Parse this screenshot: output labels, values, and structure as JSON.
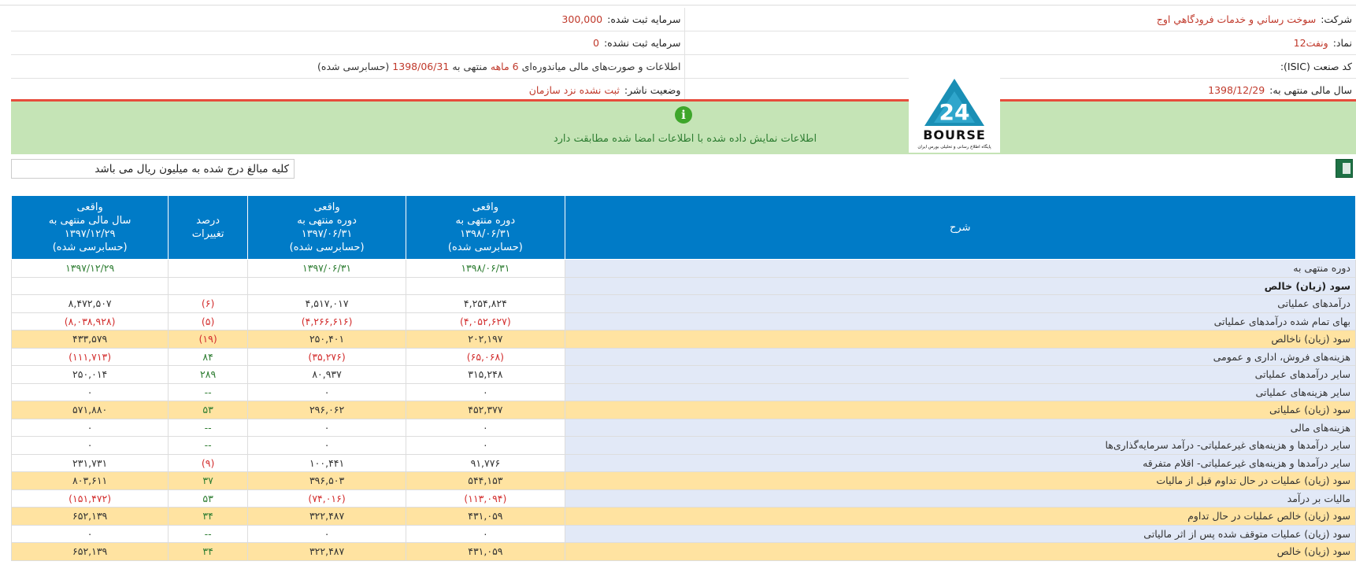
{
  "header": {
    "company_label": "شرکت:",
    "company_value": "سوخت رساني و خدمات فرودگاهي اوج",
    "registered_capital_label": "سرمایه ثبت شده:",
    "registered_capital_value": "300,000",
    "symbol_label": "نماد:",
    "symbol_value": "ونفت12",
    "unregistered_capital_label": "سرمایه ثبت نشده:",
    "unregistered_capital_value": "0",
    "isic_label": "کد صنعت (ISIC):",
    "isic_value": "",
    "report_text_1": "اطلاعات و صورت‌های مالی میاندوره‌ای",
    "report_period": "6 ماهه",
    "report_text_2": "منتهی به",
    "report_date": "1398/06/31",
    "report_text_3": "(حسابرسی شده)",
    "fiscal_year_label": "سال مالی منتهی به:",
    "fiscal_year_value": "1398/12/29",
    "publisher_status_label": "وضعیت ناشر:",
    "publisher_status_value": "ثبت نشده نزد سازمان"
  },
  "logo": {
    "brand": "BOURSE",
    "number": "24",
    "tagline": "پایگاه اطلاع رسانی و تحلیلی بورس ایران"
  },
  "notice": {
    "icon": "info-icon",
    "text": "اطلاعات نمایش داده شده با اطلاعات امضا شده مطابقت دارد"
  },
  "unit_note": "کلیه مبالغ درج شده به میلیون ریال می باشد",
  "excel_icon": "excel-export-icon",
  "colors": {
    "header_blue": "#007bc7",
    "highlight_row": "#ffe3a1",
    "desc_bg": "#e2e9f7",
    "positive": "#2e7d32",
    "negative": "#d32f2f"
  },
  "table": {
    "headers": {
      "desc": "شرح",
      "col1": [
        "واقعی",
        "دوره منتهی به",
        "۱۳۹۸/۰۶/۳۱",
        "(حسابرسی شده)"
      ],
      "col2": [
        "واقعی",
        "دوره منتهی به",
        "۱۳۹۷/۰۶/۳۱",
        "(حسابرسی شده)"
      ],
      "col3": [
        "درصد",
        "تغییرات"
      ],
      "col4": [
        "واقعی",
        "سال مالی منتهی به",
        "۱۳۹۷/۱۲/۲۹",
        "(حسابرسی شده)"
      ]
    },
    "rows": [
      {
        "desc": "دوره منتهی به",
        "c1": "۱۳۹۸/۰۶/۳۱",
        "c2": "۱۳۹۷/۰۶/۳۱",
        "c3": "",
        "c4": "۱۳۹۷/۱۲/۲۹",
        "type": "period"
      },
      {
        "desc": "سود (زیان) خالص",
        "c1": "",
        "c2": "",
        "c3": "",
        "c4": "",
        "type": "bold"
      },
      {
        "desc": "درآمدهای عملیاتی",
        "c1": "۴,۲۵۴,۸۲۴",
        "c2": "۴,۵۱۷,۰۱۷",
        "c3": "(۶)",
        "c4": "۸,۴۷۲,۵۰۷",
        "c3neg": true
      },
      {
        "desc": "بهای تمام شده درآمدهای عملیاتی",
        "c1": "(۴,۰۵۲,۶۲۷)",
        "c2": "(۴,۲۶۶,۶۱۶)",
        "c3": "(۵)",
        "c4": "(۸,۰۳۸,۹۲۸)",
        "neg": true,
        "c3neg": true
      },
      {
        "desc": "سود (زیان) ناخالص",
        "c1": "۲۰۲,۱۹۷",
        "c2": "۲۵۰,۴۰۱",
        "c3": "(۱۹)",
        "c4": "۴۳۳,۵۷۹",
        "type": "hl",
        "c3neg": true
      },
      {
        "desc": "هزینه‌های فروش، اداری و عمومی",
        "c1": "(۶۵,۰۶۸)",
        "c2": "(۳۵,۲۷۶)",
        "c3": "۸۴",
        "c4": "(۱۱۱,۷۱۳)",
        "neg": true
      },
      {
        "desc": "سایر درآمدهای عملیاتی",
        "c1": "۳۱۵,۲۴۸",
        "c2": "۸۰,۹۳۷",
        "c3": "۲۸۹",
        "c4": "۲۵۰,۰۱۴"
      },
      {
        "desc": "سایر هزینه‌های عملیاتی",
        "c1": "۰",
        "c2": "۰",
        "c3": "--",
        "c4": "۰"
      },
      {
        "desc": "سود (زیان) عملیاتی",
        "c1": "۴۵۲,۳۷۷",
        "c2": "۲۹۶,۰۶۲",
        "c3": "۵۳",
        "c4": "۵۷۱,۸۸۰",
        "type": "hl"
      },
      {
        "desc": "هزینه‌های مالی",
        "c1": "۰",
        "c2": "۰",
        "c3": "--",
        "c4": "۰"
      },
      {
        "desc": "سایر درآمدها و هزینه‌های غیرعملیاتی- درآمد سرمایه‌گذاری‌ها",
        "c1": "۰",
        "c2": "۰",
        "c3": "--",
        "c4": "۰"
      },
      {
        "desc": "سایر درآمدها و هزینه‌های غیرعملیاتی- اقلام متفرقه",
        "c1": "۹۱,۷۷۶",
        "c2": "۱۰۰,۴۴۱",
        "c3": "(۹)",
        "c4": "۲۳۱,۷۳۱",
        "c3neg": true
      },
      {
        "desc": "سود (زیان) عملیات در حال تداوم قبل از مالیات",
        "c1": "۵۴۴,۱۵۳",
        "c2": "۳۹۶,۵۰۳",
        "c3": "۳۷",
        "c4": "۸۰۳,۶۱۱",
        "type": "hl"
      },
      {
        "desc": "مالیات بر درآمد",
        "c1": "(۱۱۳,۰۹۴)",
        "c2": "(۷۴,۰۱۶)",
        "c3": "۵۳",
        "c4": "(۱۵۱,۴۷۲)",
        "neg": true
      },
      {
        "desc": "سود (زیان) خالص عملیات در حال تداوم",
        "c1": "۴۳۱,۰۵۹",
        "c2": "۳۲۲,۴۸۷",
        "c3": "۳۴",
        "c4": "۶۵۲,۱۳۹",
        "type": "hl"
      },
      {
        "desc": "سود (زیان) عملیات متوقف شده پس از اثر مالیاتی",
        "c1": "۰",
        "c2": "۰",
        "c3": "--",
        "c4": "۰"
      },
      {
        "desc": "سود (زیان) خالص",
        "c1": "۴۳۱,۰۵۹",
        "c2": "۳۲۲,۴۸۷",
        "c3": "۳۴",
        "c4": "۶۵۲,۱۳۹",
        "type": "hl"
      }
    ]
  }
}
